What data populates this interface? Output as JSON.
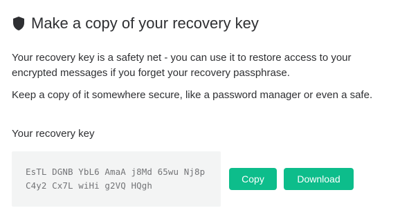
{
  "dialog": {
    "title": "Make a copy of your recovery key",
    "title_icon": "shield-icon",
    "description": "Your recovery key is a safety net - you can use it to restore access to your encrypted messages if you forget your recovery passphrase.",
    "advice": "Keep a copy of it somewhere secure, like a password manager or even a safe.",
    "key_label": "Your recovery key",
    "recovery_key": "EsTL DGNB YbL6 AmaA j8Md 65wu Nj8p C4y2 Cx7L wiHi g2VQ HQgh",
    "buttons": {
      "copy": "Copy",
      "download": "Download"
    }
  },
  "colors": {
    "accent": "#0dbd8b",
    "text": "#2e2f32",
    "key_background": "#f3f4f4",
    "key_text": "#737477"
  }
}
